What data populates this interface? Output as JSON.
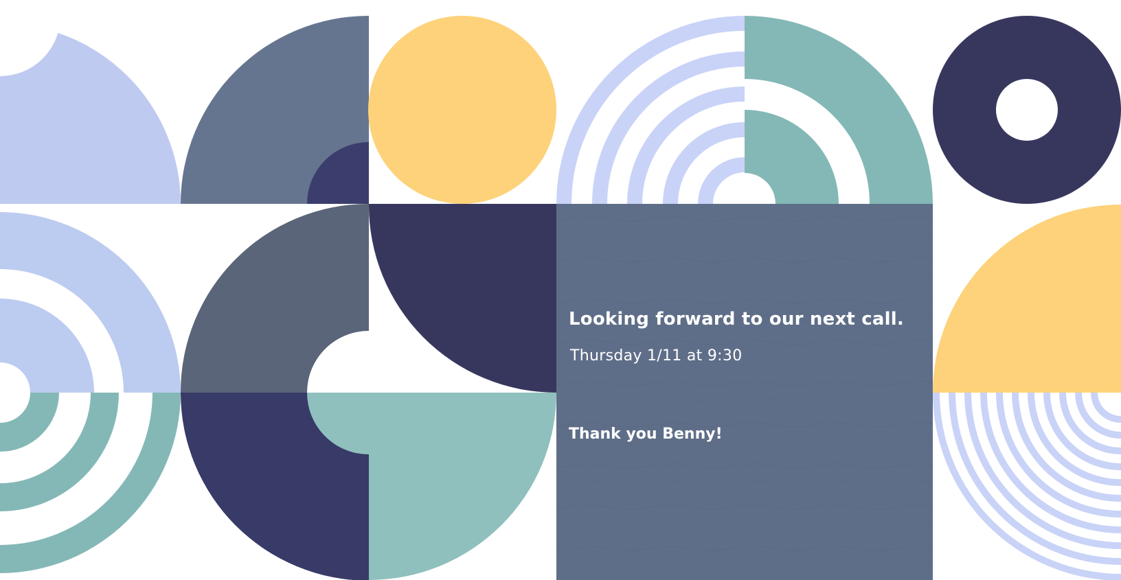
{
  "slide": {
    "headline": "Looking forward to our next call.",
    "subline": "Thursday 1/11  at 9:30",
    "thanks": "Thank you Benny!"
  },
  "palette": {
    "periwinkle": "#bfcaf1",
    "periwinkle_light": "#c9d3f7",
    "slate": "#66758f",
    "slate_dark": "#5a6579",
    "navy": "#37375e",
    "navy_dark": "#383a67",
    "teal": "#84b8b6",
    "teal_light": "#8fc0bd",
    "yellow": "#fdd27a",
    "panel": "#5f6e88",
    "text": "#ffffff"
  }
}
